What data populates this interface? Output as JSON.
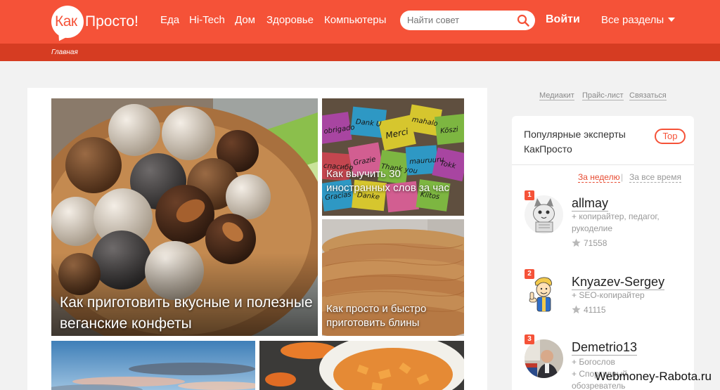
{
  "header": {
    "logo_prefix": "Как",
    "logo_suffix": "Просто!",
    "nav": [
      "Еда",
      "Hi-Tech",
      "Дом",
      "Здоровье",
      "Компьютеры"
    ],
    "search_placeholder": "Найти совет",
    "login_label": "Войти",
    "sections_label": "Все разделы"
  },
  "breadcrumb": {
    "home": "Главная"
  },
  "tiles": [
    {
      "title": "Как приготовить вкусные и полезные веганские конфеты"
    },
    {
      "title": "Как выучить 30 иностранных слов за час"
    },
    {
      "title": "Как просто и быстро приготовить блины"
    }
  ],
  "sticky_words": [
    "obrigado",
    "Dank U",
    "Merci",
    "mahalo",
    "Köszi",
    "спасибо",
    "Grazie",
    "Thank you",
    "mauruuru",
    "Tokk",
    "Gracias",
    "Danke",
    "Kiitos"
  ],
  "sidebar": {
    "links": [
      "Медиакит",
      "Прайс-лист",
      "Связаться"
    ],
    "experts_title": "Популярные эксперты КакПросто",
    "top_badge": "Top",
    "period_week": "За неделю",
    "period_separator": "|",
    "period_all": "За все время",
    "experts": [
      {
        "rank": "1",
        "name": "allmay",
        "tags": "+ копирайтер, педагог, рукоделие",
        "score": "71558"
      },
      {
        "rank": "2",
        "name": "Knyazev-Sergey",
        "tags": "+ SEO-копирайтер",
        "score": "41115"
      },
      {
        "rank": "3",
        "name": "Demetrio13",
        "tags": "+ Богослов\n+ Спортивный обозреватель",
        "score": ""
      }
    ]
  },
  "watermark": "Webmoney-Rabota.ru",
  "colors": {
    "brand": "#f55238",
    "brand_dark": "#d63c22",
    "page_bg": "#f2f2f2"
  }
}
